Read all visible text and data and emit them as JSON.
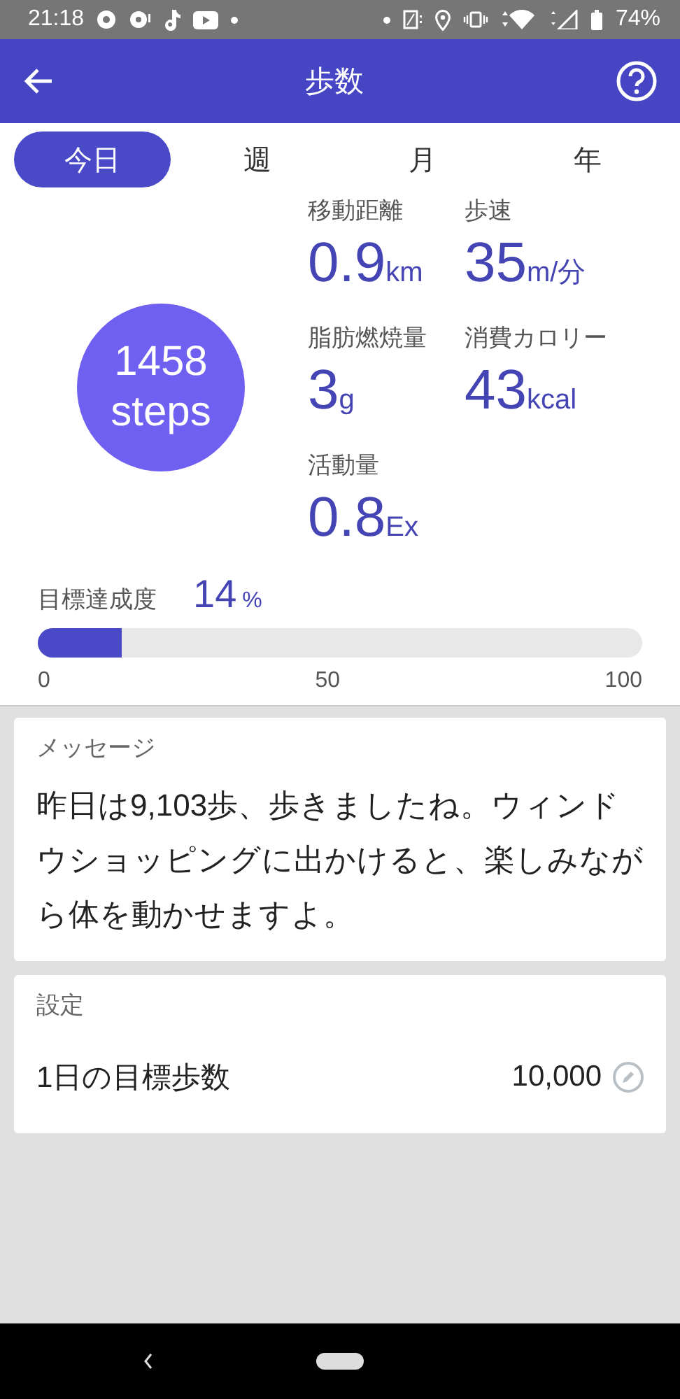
{
  "status_bar": {
    "time": "21:18",
    "battery": "74%"
  },
  "app_bar": {
    "title": "歩数"
  },
  "tabs": [
    {
      "label": "今日",
      "selected": true
    },
    {
      "label": "週",
      "selected": false
    },
    {
      "label": "月",
      "selected": false
    },
    {
      "label": "年",
      "selected": false
    }
  ],
  "steps": {
    "count": "1458",
    "unit": "steps"
  },
  "metrics": [
    {
      "label": "移動距離",
      "value": "0.9",
      "unit": "km"
    },
    {
      "label": "歩速",
      "value": "35",
      "unit": "m/分"
    },
    {
      "label": "脂肪燃焼量",
      "value": "3",
      "unit": "g"
    },
    {
      "label": "消費カロリー",
      "value": "43",
      "unit": "kcal"
    },
    {
      "label": "活動量",
      "value": "0.8",
      "unit": "Ex"
    }
  ],
  "goal": {
    "label": "目標達成度",
    "percent": "14",
    "percent_unit": "%",
    "level": 0.14,
    "ticks": [
      "0",
      "50",
      "100"
    ]
  },
  "message_card": {
    "title": "メッセージ",
    "text": "昨日は9,103歩、歩きましたね。ウィンドウショッピングに出かけると、楽しみながら体を動かせますよ。"
  },
  "settings_card": {
    "title": "設定",
    "items": [
      {
        "label": "1日の目標歩数",
        "value": "10,000"
      }
    ]
  }
}
